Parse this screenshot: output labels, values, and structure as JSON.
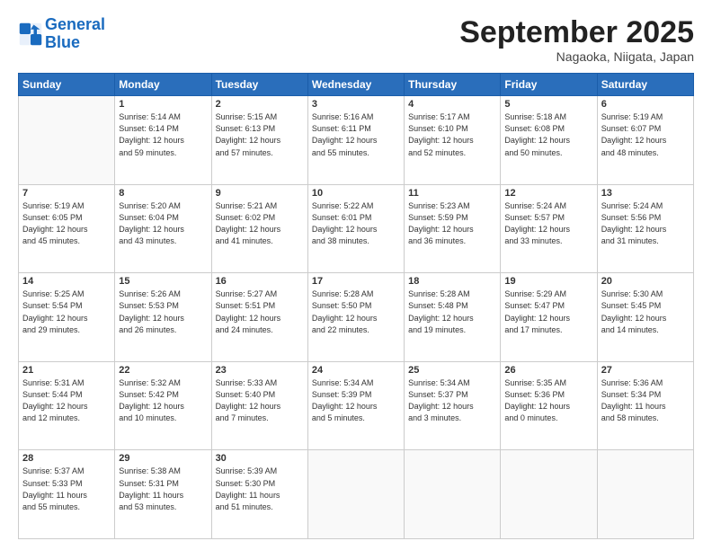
{
  "header": {
    "logo_line1": "General",
    "logo_line2": "Blue",
    "month": "September 2025",
    "location": "Nagaoka, Niigata, Japan"
  },
  "days_of_week": [
    "Sunday",
    "Monday",
    "Tuesday",
    "Wednesday",
    "Thursday",
    "Friday",
    "Saturday"
  ],
  "weeks": [
    [
      {
        "day": "",
        "text": ""
      },
      {
        "day": "1",
        "text": "Sunrise: 5:14 AM\nSunset: 6:14 PM\nDaylight: 12 hours\nand 59 minutes."
      },
      {
        "day": "2",
        "text": "Sunrise: 5:15 AM\nSunset: 6:13 PM\nDaylight: 12 hours\nand 57 minutes."
      },
      {
        "day": "3",
        "text": "Sunrise: 5:16 AM\nSunset: 6:11 PM\nDaylight: 12 hours\nand 55 minutes."
      },
      {
        "day": "4",
        "text": "Sunrise: 5:17 AM\nSunset: 6:10 PM\nDaylight: 12 hours\nand 52 minutes."
      },
      {
        "day": "5",
        "text": "Sunrise: 5:18 AM\nSunset: 6:08 PM\nDaylight: 12 hours\nand 50 minutes."
      },
      {
        "day": "6",
        "text": "Sunrise: 5:19 AM\nSunset: 6:07 PM\nDaylight: 12 hours\nand 48 minutes."
      }
    ],
    [
      {
        "day": "7",
        "text": "Sunrise: 5:19 AM\nSunset: 6:05 PM\nDaylight: 12 hours\nand 45 minutes."
      },
      {
        "day": "8",
        "text": "Sunrise: 5:20 AM\nSunset: 6:04 PM\nDaylight: 12 hours\nand 43 minutes."
      },
      {
        "day": "9",
        "text": "Sunrise: 5:21 AM\nSunset: 6:02 PM\nDaylight: 12 hours\nand 41 minutes."
      },
      {
        "day": "10",
        "text": "Sunrise: 5:22 AM\nSunset: 6:01 PM\nDaylight: 12 hours\nand 38 minutes."
      },
      {
        "day": "11",
        "text": "Sunrise: 5:23 AM\nSunset: 5:59 PM\nDaylight: 12 hours\nand 36 minutes."
      },
      {
        "day": "12",
        "text": "Sunrise: 5:24 AM\nSunset: 5:57 PM\nDaylight: 12 hours\nand 33 minutes."
      },
      {
        "day": "13",
        "text": "Sunrise: 5:24 AM\nSunset: 5:56 PM\nDaylight: 12 hours\nand 31 minutes."
      }
    ],
    [
      {
        "day": "14",
        "text": "Sunrise: 5:25 AM\nSunset: 5:54 PM\nDaylight: 12 hours\nand 29 minutes."
      },
      {
        "day": "15",
        "text": "Sunrise: 5:26 AM\nSunset: 5:53 PM\nDaylight: 12 hours\nand 26 minutes."
      },
      {
        "day": "16",
        "text": "Sunrise: 5:27 AM\nSunset: 5:51 PM\nDaylight: 12 hours\nand 24 minutes."
      },
      {
        "day": "17",
        "text": "Sunrise: 5:28 AM\nSunset: 5:50 PM\nDaylight: 12 hours\nand 22 minutes."
      },
      {
        "day": "18",
        "text": "Sunrise: 5:28 AM\nSunset: 5:48 PM\nDaylight: 12 hours\nand 19 minutes."
      },
      {
        "day": "19",
        "text": "Sunrise: 5:29 AM\nSunset: 5:47 PM\nDaylight: 12 hours\nand 17 minutes."
      },
      {
        "day": "20",
        "text": "Sunrise: 5:30 AM\nSunset: 5:45 PM\nDaylight: 12 hours\nand 14 minutes."
      }
    ],
    [
      {
        "day": "21",
        "text": "Sunrise: 5:31 AM\nSunset: 5:44 PM\nDaylight: 12 hours\nand 12 minutes."
      },
      {
        "day": "22",
        "text": "Sunrise: 5:32 AM\nSunset: 5:42 PM\nDaylight: 12 hours\nand 10 minutes."
      },
      {
        "day": "23",
        "text": "Sunrise: 5:33 AM\nSunset: 5:40 PM\nDaylight: 12 hours\nand 7 minutes."
      },
      {
        "day": "24",
        "text": "Sunrise: 5:34 AM\nSunset: 5:39 PM\nDaylight: 12 hours\nand 5 minutes."
      },
      {
        "day": "25",
        "text": "Sunrise: 5:34 AM\nSunset: 5:37 PM\nDaylight: 12 hours\nand 3 minutes."
      },
      {
        "day": "26",
        "text": "Sunrise: 5:35 AM\nSunset: 5:36 PM\nDaylight: 12 hours\nand 0 minutes."
      },
      {
        "day": "27",
        "text": "Sunrise: 5:36 AM\nSunset: 5:34 PM\nDaylight: 11 hours\nand 58 minutes."
      }
    ],
    [
      {
        "day": "28",
        "text": "Sunrise: 5:37 AM\nSunset: 5:33 PM\nDaylight: 11 hours\nand 55 minutes."
      },
      {
        "day": "29",
        "text": "Sunrise: 5:38 AM\nSunset: 5:31 PM\nDaylight: 11 hours\nand 53 minutes."
      },
      {
        "day": "30",
        "text": "Sunrise: 5:39 AM\nSunset: 5:30 PM\nDaylight: 11 hours\nand 51 minutes."
      },
      {
        "day": "",
        "text": ""
      },
      {
        "day": "",
        "text": ""
      },
      {
        "day": "",
        "text": ""
      },
      {
        "day": "",
        "text": ""
      }
    ]
  ]
}
